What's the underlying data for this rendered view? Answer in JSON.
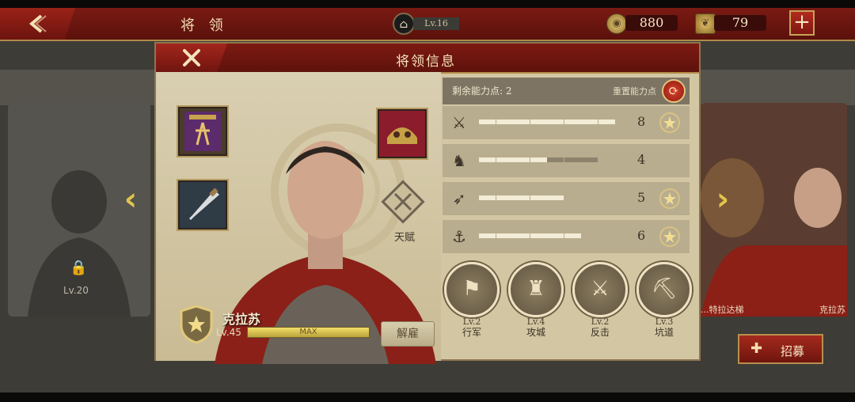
{
  "topbar": {
    "title": "将 领",
    "level_badge": "Lv.16",
    "resources": [
      {
        "icon": "coin-icon",
        "value": "880"
      },
      {
        "icon": "laurel-chest-icon",
        "value": "79"
      }
    ],
    "plus_label": "+"
  },
  "background": {
    "left_card": {
      "level": "Lv.20",
      "locked": true
    },
    "right_cards": [
      {
        "name": "...特拉达梯"
      },
      {
        "name": "克拉苏"
      }
    ],
    "recruit_label": "招募"
  },
  "modal": {
    "title": "将领信息",
    "talent_label": "天赋",
    "general": {
      "name": "克拉苏",
      "level": "Lv.45",
      "progress_label": "MAX",
      "progress": 1.0
    },
    "dismiss_label": "解雇",
    "points": {
      "label": "剩余能力点: 2",
      "reset_label": "重置能力点"
    },
    "stats": [
      {
        "icon": "sword-icon",
        "filled": 8,
        "total": 8,
        "value": "8",
        "star": true
      },
      {
        "icon": "horse-icon",
        "filled": 4,
        "total": 7,
        "value": "4",
        "star": false
      },
      {
        "icon": "bow-icon",
        "filled": 5,
        "total": 5,
        "value": "5",
        "star": true
      },
      {
        "icon": "anchor-icon",
        "filled": 6,
        "total": 6,
        "value": "6",
        "star": true
      }
    ],
    "abilities": [
      {
        "level": "Lv.2",
        "name": "行军",
        "icon": "march-icon"
      },
      {
        "level": "Lv.4",
        "name": "攻城",
        "icon": "siege-icon"
      },
      {
        "level": "Lv.2",
        "name": "反击",
        "icon": "counterattack-icon"
      },
      {
        "level": "Lv.3",
        "name": "坑道",
        "icon": "tunnel-icon"
      }
    ]
  }
}
